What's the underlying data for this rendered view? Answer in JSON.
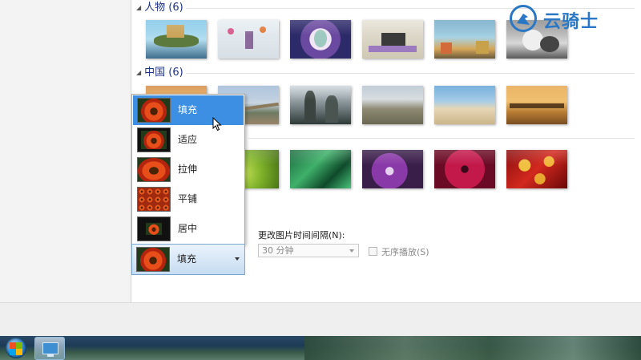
{
  "groups": [
    {
      "title": "人物 (6)"
    },
    {
      "title": "中国 (6)"
    }
  ],
  "picture_position": {
    "options": [
      {
        "label": "填充",
        "selected": true
      },
      {
        "label": "适应",
        "selected": false
      },
      {
        "label": "拉伸",
        "selected": false
      },
      {
        "label": "平铺",
        "selected": false
      },
      {
        "label": "居中",
        "selected": false
      }
    ],
    "current": "填充"
  },
  "slideshow": {
    "interval_label": "更改图片时间间隔(N):",
    "interval_value": "30 分钟",
    "shuffle_label": "无序播放(S)",
    "shuffle_checked": false
  },
  "watermark": {
    "text": "云骑士"
  },
  "colors": {
    "group_title": "#1e3287",
    "selection": "#3d8fe3",
    "watermark": "#2a78c5"
  }
}
